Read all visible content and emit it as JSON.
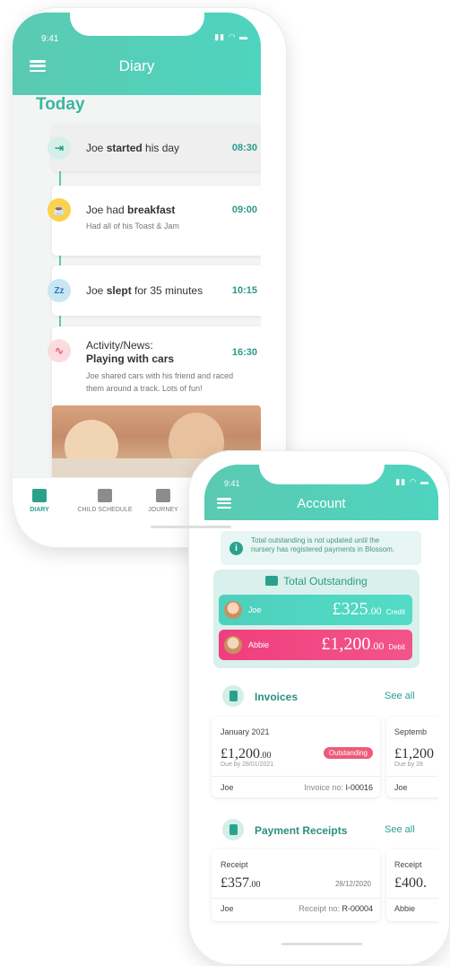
{
  "diary": {
    "status_time": "9:41",
    "title": "Diary",
    "section": "Today",
    "entries": [
      {
        "icon": "sign-in-icon",
        "pre": "Joe ",
        "bold": "started",
        "post": " his day",
        "time": "08:30",
        "color": "#d7efe9",
        "icon_color": "#2aa18c"
      },
      {
        "icon": "food-icon",
        "pre": "Joe had ",
        "bold": "breakfast",
        "post": "",
        "time": "09:00",
        "sub": "Had all of his Toast & Jam",
        "color": "#fbd24a",
        "icon_color": "#fff"
      },
      {
        "icon": "sleep-icon",
        "pre": "Joe ",
        "bold": "slept",
        "post": " for 35 minutes",
        "time": "10:15",
        "color": "#c9e6f4",
        "icon_color": "#2a7db4"
      },
      {
        "icon": "activity-icon",
        "pre": "Activity/News:",
        "bold": "Playing with cars",
        "post": "",
        "time": "16:30",
        "sub1": "Joe shared cars with his friend and raced",
        "sub2": "them around a track. Lots of fun!",
        "color": "#fadcdf",
        "icon_color": "#ef5a7b"
      }
    ],
    "tabs": [
      "DIARY",
      "CHILD SCHEDULE",
      "JOURNEY"
    ]
  },
  "account": {
    "status_time": "9:41",
    "title": "Account",
    "info_line1": "Total outstanding is not updated until the",
    "info_line2": "nursery has registered payments in Blossom.",
    "total_label": "Total Outstanding",
    "balances": [
      {
        "name": "Joe",
        "currency": "£",
        "whole": "325",
        "dec": ".00",
        "label": "Credit",
        "color": "#4dd0bd"
      },
      {
        "name": "Abbie",
        "currency": "£",
        "whole": "1,200",
        "dec": ".00",
        "label": "Debit",
        "color": "#f03e7d"
      }
    ],
    "invoices_title": "Invoices",
    "invoices_see_all": "See all",
    "invoices": [
      {
        "month": "January 2021",
        "amount": "£1,200",
        "dec": ".00",
        "due": "Due by 28/01/2021",
        "status": "Outstanding",
        "child": "Joe",
        "inv_label": "Invoice no:",
        "inv_no": "I-00016"
      },
      {
        "month": "Septemb",
        "amount": "£1,200",
        "dec": "",
        "due": "Due by 28",
        "child": "Joe"
      }
    ],
    "receipts_title": "Payment Receipts",
    "receipts_see_all": "See all",
    "receipts": [
      {
        "label": "Receipt",
        "amount": "£357",
        "dec": ".00",
        "date": "28/12/2020",
        "child": "Joe",
        "rec_label": "Receipt no:",
        "rec_no": "R-00004"
      },
      {
        "label": "Receipt",
        "amount": "£400.",
        "child": "Abbie"
      }
    ]
  }
}
